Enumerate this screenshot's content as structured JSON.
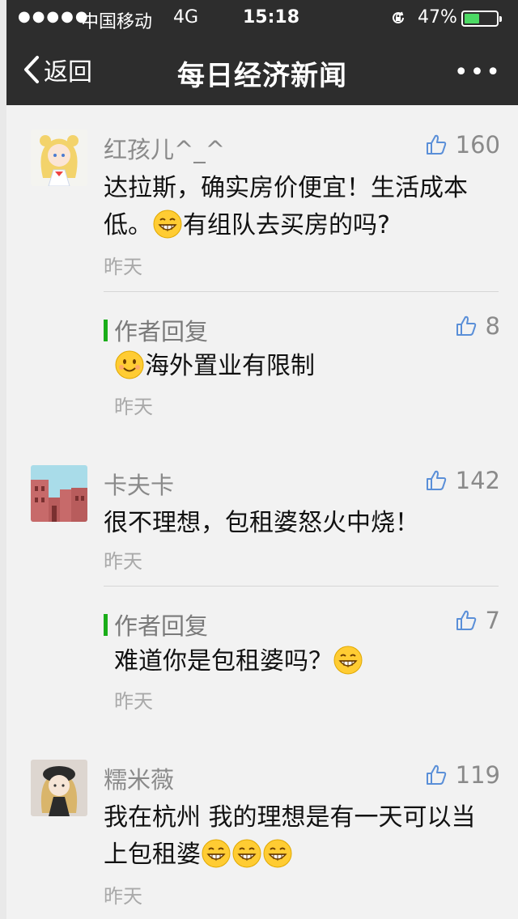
{
  "status_bar": {
    "signal": "●●●●●",
    "carrier": "中国移动",
    "network": "4G",
    "time": "15:18",
    "battery_percent": "47%",
    "battery_level": 0.47
  },
  "nav": {
    "back_label": "返回",
    "title": "每日经济新闻",
    "more_label": "•••"
  },
  "comments": [
    {
      "author": "红孩儿^_^",
      "likes": "160",
      "text_a": "达拉斯，确实房价便宜！生活成本",
      "text_b": "低。",
      "text_c": "有组队去买房的吗?",
      "time": "昨天",
      "reply": {
        "label": "作者回复",
        "likes": "8",
        "text": "海外置业有限制",
        "time": "昨天"
      }
    },
    {
      "author": "卡夫卡",
      "likes": "142",
      "text": "很不理想，包租婆怒火中烧！",
      "time": "昨天",
      "reply": {
        "label": "作者回复",
        "likes": "7",
        "text": "难道你是包租婆吗？",
        "time": "昨天"
      }
    },
    {
      "author": "糯米薇",
      "likes": "119",
      "text_a": "我在杭州 我的理想是有一天可以当",
      "text_b": "上包租婆",
      "time": "昨天"
    }
  ],
  "colors": {
    "nav_bg": "#2d2d2d",
    "reply_accent": "#1aad19",
    "page_bg": "#f2f2f2"
  }
}
